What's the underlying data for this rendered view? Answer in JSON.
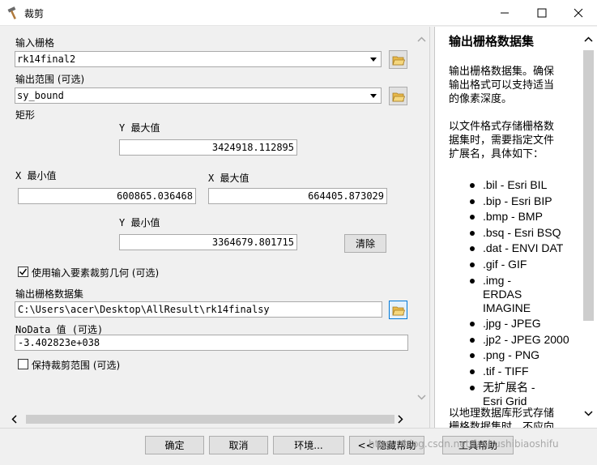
{
  "window": {
    "title": "裁剪"
  },
  "form": {
    "input_raster_label": "输入栅格",
    "input_raster_value": "rk14final2",
    "output_extent_label": "输出范围 (可选)",
    "output_extent_value": "sy_bound",
    "rectangle_label": "矩形",
    "y_max_label": "Y 最大值",
    "y_max_value": "3424918.112895",
    "x_min_label": "X 最小值",
    "x_min_value": "600865.036468",
    "x_max_label": "X 最大值",
    "x_max_value": "664405.873029",
    "y_min_label": "Y 最小值",
    "y_min_value": "3364679.801715",
    "clear_button": "清除",
    "use_features_label": "使用输入要素裁剪几何 (可选)",
    "use_features_checked": true,
    "output_dataset_label": "输出栅格数据集",
    "output_dataset_value": "C:\\Users\\acer\\Desktop\\AllResult\\rk14finalsy",
    "nodata_label": "NoData 值 (可选)",
    "nodata_value": "-3.402823e+038",
    "maintain_extent_label": "保持裁剪范围 (可选)",
    "maintain_extent_checked": false
  },
  "help": {
    "title": "输出栅格数据集",
    "para1_lines": [
      "输出栅格数据集。确保",
      "输出格式可以支持适当",
      "的像素深度。"
    ],
    "para2_lines": [
      "以文件格式存储栅格数",
      "据集时，需要指定文件",
      "扩展名，具体如下："
    ],
    "formats": [
      ".bil - Esri BIL",
      ".bip - Esri BIP",
      ".bmp - BMP",
      ".bsq - Esri BSQ",
      ".dat - ENVI DAT",
      ".gif - GIF",
      ".img - ERDAS IMAGINE",
      ".jpg - JPEG",
      ".jp2 - JPEG 2000",
      ".png - PNG",
      ".tif - TIFF",
      "无扩展名 - Esri Grid"
    ],
    "para3_lines": [
      "以地理数据库形式存储",
      "栅格数据集时，不应向"
    ]
  },
  "buttons": {
    "ok": "确定",
    "cancel": "取消",
    "environments": "环境...",
    "hide_help": "<< 隐藏帮助",
    "tool_help": "工具帮助"
  },
  "watermark": "https://blog.csdn.net/fanbushibiaoshifu",
  "icons": {
    "title": "hammer-icon",
    "folder": "open-folder-icon",
    "dropdown": "dropdown-arrow-icon",
    "minimize": "minimize-icon",
    "maximize": "maximize-icon",
    "close": "close-icon"
  },
  "colors": {
    "accent": "#0078d7",
    "folder": "#e8b94a"
  }
}
